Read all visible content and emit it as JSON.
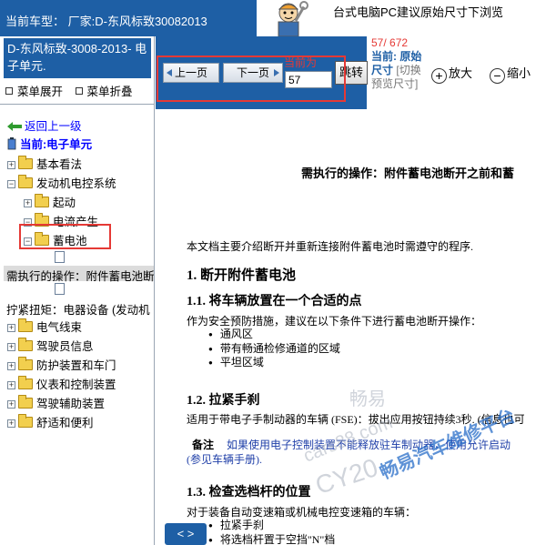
{
  "header": {
    "car_model": "当前车型：  厂家:D-东风标致30082013",
    "notice": "台式电脑PC建议原始尺寸下浏览"
  },
  "sidebar": {
    "title": "D-东风标致-3008-2013- 电子单元.",
    "menu_expand": "菜单展开",
    "menu_collapse": "菜单折叠",
    "back_link": "返回上一级",
    "current": "当前:电子单元",
    "items": [
      {
        "label": "基本看法"
      },
      {
        "label": "发动机电控系统"
      },
      {
        "label": "起动"
      },
      {
        "label": "电流产生"
      },
      {
        "label": "蓄电池"
      },
      {
        "label": "需执行的操作：附件蓄电池断"
      },
      {
        "label": "拧紧扭矩：电器设备 (发动机"
      },
      {
        "label": "电气线束"
      },
      {
        "label": "驾驶员信息"
      },
      {
        "label": "防护装置和车门"
      },
      {
        "label": "仪表和控制装置"
      },
      {
        "label": "驾驶辅助装置"
      },
      {
        "label": "舒适和便利"
      }
    ]
  },
  "toolbar": {
    "prev_label": "上一页",
    "next_label": "下一页",
    "page_label": "当前为",
    "page_value": "57",
    "jump_label": "跳转",
    "page_count": "57/ 672",
    "size_current": "当前: 原始尺寸",
    "size_toggle": "[切换预览尺寸]",
    "zoom_in": "放大",
    "zoom_out": "缩小"
  },
  "content": {
    "main_heading": "需执行的操作：附件蓄电池断开之前和蓄",
    "intro": "本文档主要介绍断开并重新连接附件蓄电池时需遵守的程序.",
    "section1": "1. 断开附件蓄电池",
    "section1_1": "1.1. 将车辆放置在一个合适的点",
    "para1": "作为安全预防措施，建议在以下条件下进行蓄电池断开操作：",
    "bullets1": [
      "通风区",
      "带有畅通检修通道的区域",
      "平坦区域"
    ],
    "section1_2": "1.2. 拉紧手刹",
    "para2": "适用于带电子手制动器的车辆 (FSE)：拔出应用按钮持续3秒. (信息也可",
    "note_label": "备注",
    "note_line1": "如果使用电子控制装置不能释放驻车制动器，使用允许启动",
    "note_line2": "(参见车辆手册).",
    "section1_3": "1.3. 检查选档杆的位置",
    "para3": "对于装备自动变速箱或机械电控变速箱的车辆：",
    "bullets2": [
      "拉紧手刹",
      "将选档杆置于空挡\"N\"档"
    ],
    "scroll_label": "< >"
  },
  "watermarks": {
    "w1": "畅易",
    "w2": "cars88.com",
    "w3": "CY20",
    "w4": "畅易汽车维修平台"
  }
}
